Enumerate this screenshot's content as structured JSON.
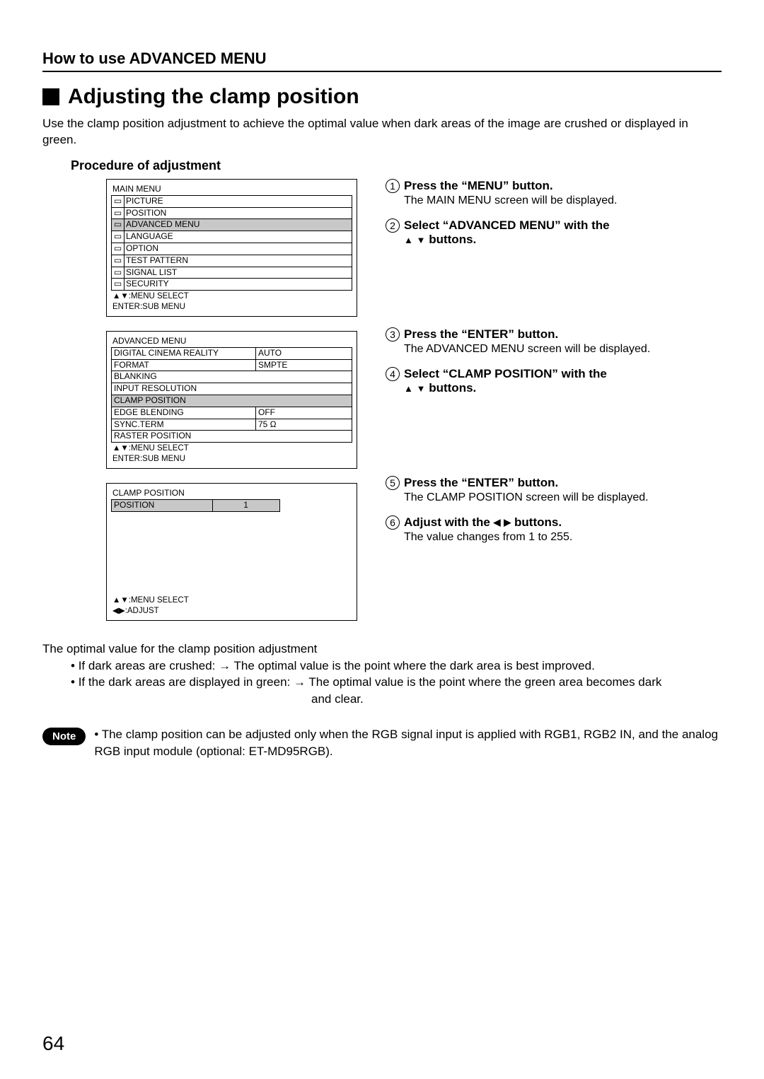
{
  "breadcrumb": "How to use ADVANCED MENU",
  "section_title": "Adjusting the clamp position",
  "intro": "Use the clamp position adjustment to achieve the optimal value when dark areas of the image are crushed or displayed in green.",
  "procedure_heading": "Procedure of adjustment",
  "main_menu": {
    "title": "MAIN MENU",
    "items": [
      {
        "label": "PICTURE"
      },
      {
        "label": "POSITION"
      },
      {
        "label": "ADVANCED MENU",
        "selected": true
      },
      {
        "label": "LANGUAGE"
      },
      {
        "label": "OPTION"
      },
      {
        "label": "TEST PATTERN"
      },
      {
        "label": "SIGNAL LIST"
      },
      {
        "label": "SECURITY"
      }
    ],
    "hint1": "▲▼:MENU SELECT",
    "hint2": "ENTER:SUB MENU"
  },
  "advanced_menu": {
    "title": "ADVANCED MENU",
    "items": [
      {
        "label": "DIGITAL CINEMA REALITY",
        "value": "AUTO"
      },
      {
        "label": "FORMAT",
        "value": "SMPTE"
      },
      {
        "label": "BLANKING",
        "value": ""
      },
      {
        "label": "INPUT RESOLUTION",
        "value": ""
      },
      {
        "label": "CLAMP POSITION",
        "value": "",
        "selected": true
      },
      {
        "label": "EDGE BLENDING",
        "value": "OFF"
      },
      {
        "label": "SYNC.TERM",
        "value": "75 Ω"
      },
      {
        "label": "RASTER POSITION",
        "value": ""
      }
    ],
    "hint1": "▲▼:MENU SELECT",
    "hint2": "ENTER:SUB MENU"
  },
  "clamp_menu": {
    "title": "CLAMP POSITION",
    "items": [
      {
        "label": "POSITION",
        "value": "1",
        "selected": true
      }
    ],
    "hint1": "▲▼:MENU SELECT",
    "hint2": "◀▶:ADJUST"
  },
  "steps": [
    {
      "num": "1",
      "title": "Press the “MENU” button.",
      "desc": "The MAIN MENU screen will be displayed."
    },
    {
      "num": "2",
      "title_pre": "Select “ADVANCED MENU” with the",
      "title_post": "  buttons."
    },
    {
      "num": "3",
      "title": "Press the “ENTER” button.",
      "desc": "The ADVANCED MENU screen will be displayed."
    },
    {
      "num": "4",
      "title_pre": "Select “CLAMP POSITION” with the",
      "title_post": "  buttons."
    },
    {
      "num": "5",
      "title": "Press the “ENTER” button.",
      "desc": "The CLAMP POSITION screen will be displayed."
    },
    {
      "num": "6",
      "title_pre": "Adjust with the ",
      "title_post": "  buttons.",
      "desc": "The value changes from 1 to 255."
    }
  ],
  "optimal": {
    "heading": "The optimal value for the clamp position adjustment",
    "b1_pre": "If dark areas are crushed:",
    "b1_post": "The optimal value is the point where the dark area is best improved.",
    "b2_pre": "If the dark areas are displayed in green:",
    "b2_post": "The optimal value is the point where the green area becomes dark",
    "b2_cont": "and clear."
  },
  "note": {
    "label": "Note",
    "text": "• The clamp position can be adjusted only when the RGB signal input is applied with RGB1, RGB2 IN, and the analog RGB input module (optional: ET-MD95RGB)."
  },
  "page_number": "64"
}
